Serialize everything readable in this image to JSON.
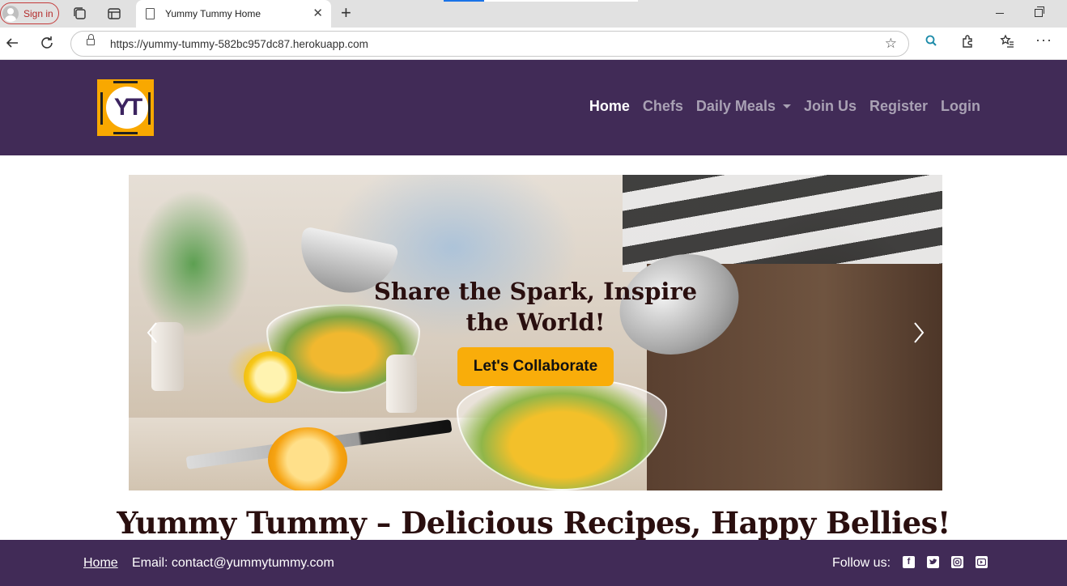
{
  "browser": {
    "signin_label": "Sign in",
    "tab_title": "Yummy Tummy Home",
    "url": "https://yummy-tummy-582bc957dc87.herokuapp.com"
  },
  "header": {
    "logo_text": "YT",
    "nav": {
      "home": "Home",
      "chefs": "Chefs",
      "daily_meals": "Daily Meals",
      "join_us": "Join Us",
      "register": "Register",
      "login": "Login"
    },
    "active_item": "Home"
  },
  "hero": {
    "caption": "Share the Spark, Inspire the World!",
    "button_label": "Let's Collaborate"
  },
  "main": {
    "title": "Yummy Tummy – Delicious Recipes, Happy Bellies!"
  },
  "footer": {
    "home_link": "Home",
    "email": "Email: contact@yummytummy.com",
    "follow_label": "Follow us:",
    "social_icons": [
      "facebook-icon",
      "twitter-icon",
      "instagram-icon",
      "youtube-icon"
    ]
  },
  "colors": {
    "brand_purple": "#412b57",
    "accent_orange": "#f9ad0a",
    "heading_dark": "#2a0f0f"
  }
}
